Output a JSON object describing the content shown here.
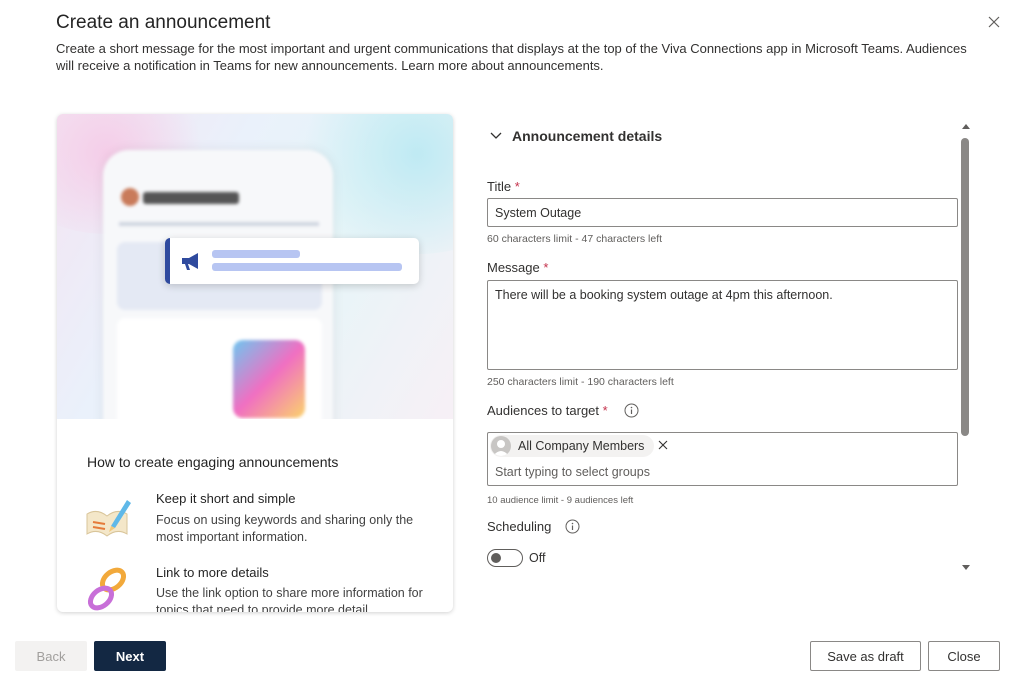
{
  "dialog": {
    "title": "Create an announcement",
    "description": "Create a short message for the most important and urgent communications that displays at the top of the Viva Connections app in Microsoft Teams. Audiences will receive a notification in Teams for new announcements.",
    "learn_more_link": "Learn more about announcements."
  },
  "illustration": {
    "tips_heading": "How to create engaging announcements",
    "tips": [
      {
        "title": "Keep it short and simple",
        "body": "Focus on using keywords and sharing only the most important information.",
        "icon": "pencil-notepad-icon"
      },
      {
        "title": "Link to more details",
        "body": "Use the link option to share more information for topics that need to provide more detail.",
        "icon": "chain-link-icon"
      }
    ]
  },
  "form": {
    "section_header": "Announcement details",
    "title_label": "Title",
    "title_value": "System Outage",
    "title_hint": "60 characters limit - 47 characters left",
    "message_label": "Message",
    "message_value": "There will be a booking system outage at 4pm this afternoon.",
    "message_hint": "250 characters limit - 190 characters left",
    "audiences_label": "Audiences to target",
    "audience_pill": "All Company Members",
    "audience_placeholder": "Start typing to select groups",
    "audience_hint": "10 audience limit - 9 audiences left",
    "scheduling_label": "Scheduling",
    "scheduling_toggle_label": "Off",
    "required_marker": "*"
  },
  "footer": {
    "back_label": "Back",
    "next_label": "Next",
    "save_draft_label": "Save as draft",
    "close_label": "Close"
  },
  "colors": {
    "primary_button": "#132843",
    "required": "#c4314b",
    "notification_accent": "#2f4a9e"
  }
}
